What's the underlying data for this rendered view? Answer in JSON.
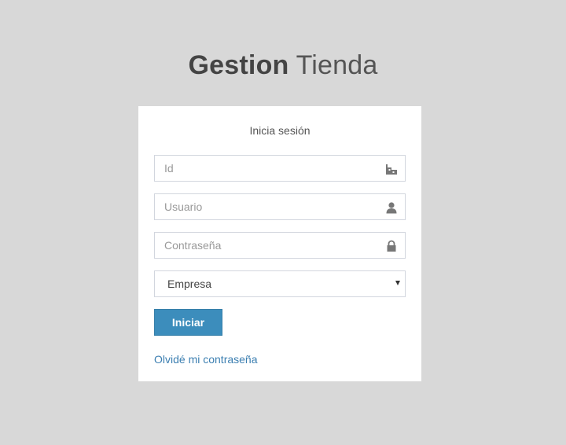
{
  "brand": {
    "bold": "Gestion",
    "light": "Tienda"
  },
  "login": {
    "message": "Inicia sesión",
    "id_placeholder": "Id",
    "user_placeholder": "Usuario",
    "password_placeholder": "Contraseña",
    "company_selected": "Empresa",
    "submit_label": "Iniciar",
    "forgot_link": "Olvidé mi contraseña"
  },
  "icons": {
    "id": "building-icon",
    "user": "user-icon",
    "password": "lock-icon",
    "select": "caret-down-icon"
  },
  "colors": {
    "background": "#d8d8d8",
    "button": "#3c8dbc",
    "link": "#3c7fb1"
  }
}
